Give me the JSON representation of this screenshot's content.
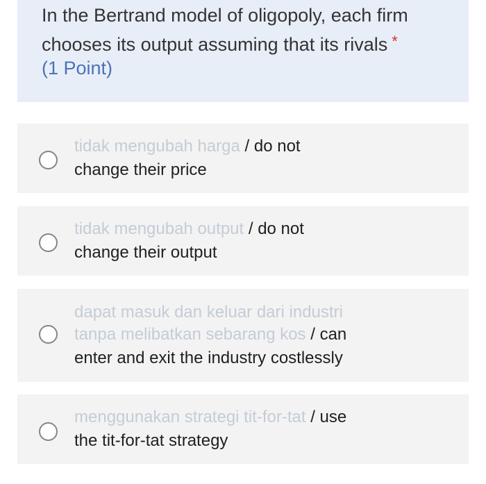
{
  "question": {
    "text": "In the Bertrand model of oligopoly, each firm chooses its output assuming that its rivals",
    "required_mark": "*",
    "points": "(1 Point)"
  },
  "options": [
    {
      "line1_faded": "tidak mengubah harga",
      "line1_end": "/ do not",
      "line2": "change their price"
    },
    {
      "line1_faded": "tidak mengubah output",
      "line1_end": "/ do not",
      "line2": "change their output"
    },
    {
      "line1_faded": "dapat masuk dan keluar dari industri",
      "line2_faded": "tanpa melibatkan sebarang kos",
      "line2_end": "/ can",
      "line3": "enter and exit the industry costlessly"
    },
    {
      "line1_faded": "menggunakan strategi tit-for-tat",
      "line1_end": "/ use",
      "line2": "the tit-for-tat strategy"
    }
  ]
}
